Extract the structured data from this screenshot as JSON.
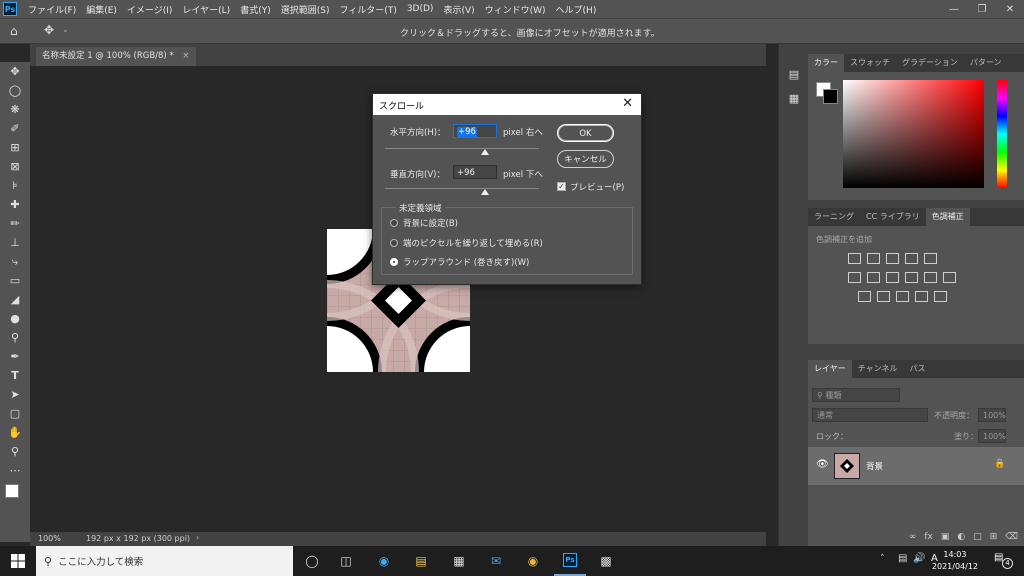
{
  "app": {
    "logo": "Ps",
    "menu": [
      "ファイル(F)",
      "編集(E)",
      "イメージ(I)",
      "レイヤー(L)",
      "書式(Y)",
      "選択範囲(S)",
      "フィルター(T)",
      "3D(D)",
      "表示(V)",
      "ウィンドウ(W)",
      "ヘルプ(H)"
    ],
    "options_message": "クリック＆ドラッグすると、画像にオフセットが適用されます。"
  },
  "document": {
    "tab_title": "名称未設定 1 @ 100% (RGB/8) *",
    "zoom": "100%",
    "size_info": "192 px x 192 px (300 ppi)"
  },
  "dialog": {
    "title": "スクロール",
    "horizontal_label": "水平方向(H)：",
    "horizontal_value": "+96",
    "horizontal_unit": "pixel 右へ",
    "vertical_label": "垂直方向(V)：",
    "vertical_value": "+96",
    "vertical_unit": "pixel 下へ",
    "ok": "OK",
    "cancel": "キャンセル",
    "preview": "プレビュー(P)",
    "group_label": "未定義領域",
    "options": [
      "背景に設定(B)",
      "端のピクセルを繰り返して埋める(R)",
      "ラップアラウンド (巻き戻す)(W)"
    ],
    "selected_option": 2
  },
  "panels": {
    "color_tabs": [
      "カラー",
      "スウォッチ",
      "グラデーション",
      "パターン"
    ],
    "adjust_tabs": [
      "ラーニング",
      "CC ライブラリ",
      "色調補正"
    ],
    "adjust_hint": "色調補正を追加",
    "layer_tabs": [
      "レイヤー",
      "チャンネル",
      "パス"
    ],
    "kind_placeholder": "種類",
    "blend_mode": "通常",
    "opacity_label": "不透明度：",
    "opacity_value": "100%",
    "lock_label": "ロック：",
    "fill_label": "塗り：",
    "fill_value": "100%",
    "layer_name": "背景"
  },
  "taskbar": {
    "search_placeholder": "ここに入力して検索",
    "ime": "A",
    "time": "14:03",
    "date": "2021/04/12",
    "notifications": "4"
  },
  "colors": {
    "accent": "#1473e6",
    "pattern_pink": "#c9a9a6"
  }
}
